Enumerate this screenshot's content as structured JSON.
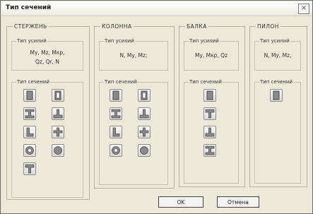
{
  "dialog": {
    "title": "Тип сечений",
    "close_label": "×"
  },
  "groups": [
    {
      "legend": "СТЕРЖЕНЬ",
      "forces_legend": "Тип усилий",
      "forces_lines": [
        "My, Mz, Mкр,",
        "Qz, Qr, N"
      ],
      "sections_legend": "Тип сечений",
      "sections": [
        "rectangle",
        "box",
        "i-beam",
        "t-beam",
        "l-angle",
        "cross",
        "ring",
        "circle",
        "t-inverted"
      ]
    },
    {
      "legend": "КОЛОННА",
      "forces_legend": "Тип усилий",
      "forces_lines": [
        "N, My, Mz;"
      ],
      "sections_legend": "Тип сечений",
      "sections": [
        "rectangle",
        "box",
        "i-beam",
        "t-beam",
        "l-angle",
        "cross",
        "ring",
        "circle"
      ]
    },
    {
      "legend": "БАЛКА",
      "forces_legend": "Тип усилий",
      "forces_lines": [
        "My, Mкр, Qz"
      ],
      "sections_legend": "Тип сечений",
      "sections": [
        "rectangle",
        "t-inverted",
        "t-beam",
        "i-beam"
      ]
    },
    {
      "legend": "ПИЛОН",
      "forces_legend": "Тип усилий",
      "forces_lines": [
        "N, My, Mz,"
      ],
      "sections_legend": "Тип сечений",
      "sections": [
        "rectangle"
      ]
    }
  ],
  "buttons": {
    "ok": "OK",
    "cancel": "Отмена"
  }
}
